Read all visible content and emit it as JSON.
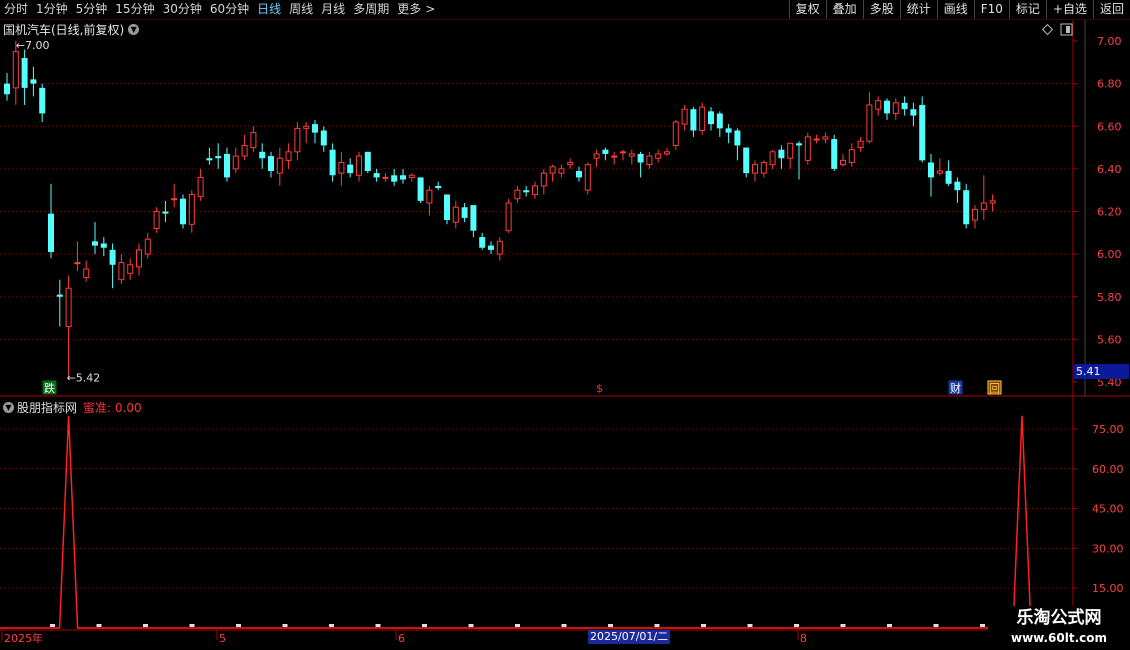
{
  "toolbar": {
    "periods": [
      "分时",
      "1分钟",
      "5分钟",
      "15分钟",
      "30分钟",
      "60分钟",
      "日线",
      "周线",
      "月线",
      "多周期",
      "更多"
    ],
    "active_period": "日线",
    "more_arrow": ">",
    "right_buttons": [
      "复权",
      "叠加",
      "多股",
      "统计",
      "画线",
      "F10",
      "标记",
      "+自选",
      "返回"
    ]
  },
  "main_chart": {
    "title": "国机汽车(日线,前复权)",
    "high_label": "7.00",
    "low_label": "5.42",
    "y_ticks": [
      "7.00",
      "6.80",
      "6.60",
      "6.40",
      "6.20",
      "6.00",
      "5.80",
      "5.60",
      "5.40"
    ],
    "current_price": "5.41",
    "markers": {
      "die": "跌",
      "s": "$",
      "cai": "财",
      "hui": "回"
    },
    "colors": {
      "up": "#ff3c3c",
      "down": "#54ffff",
      "grid": "#7a0000",
      "axis": "#b00000"
    }
  },
  "indicator": {
    "name": "股朋指标网",
    "value_label": "蜜准: 0.00",
    "y_ticks": [
      "75.00",
      "60.00",
      "45.00",
      "30.00",
      "15.00"
    ],
    "color": "#ff2020"
  },
  "x_axis": {
    "labels": [
      "2025年",
      "5",
      "6",
      "8"
    ],
    "cursor_date": "2025/07/01/二"
  },
  "watermark": {
    "line1": "乐淘公式网",
    "line2": "www.60lt.com"
  }
}
